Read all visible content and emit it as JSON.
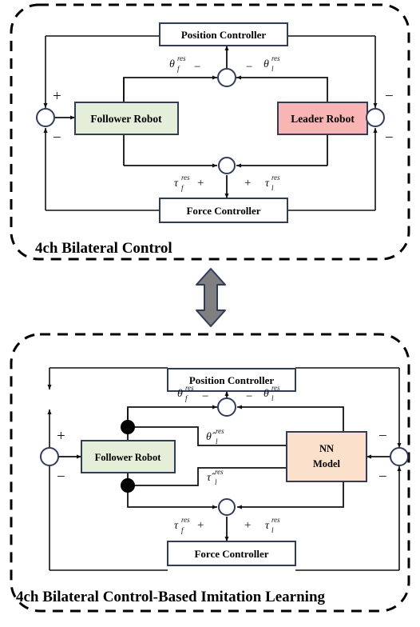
{
  "figure": {
    "type": "block-diagram",
    "description": "Two stacked dashed rounded panels showing 4ch bilateral control and its imitation-learning variant, linked by a vertical double-headed arrow."
  },
  "colors": {
    "box_border": "#2f3c5c",
    "follower_fill": "#e4eed8",
    "leader_fill": "#f9b4b4",
    "nn_fill": "#fbe0cc",
    "controller_fill": "#ffffff",
    "wire": "#111111",
    "dashed_border": "#000000",
    "swap_arrow_fill": "#808080",
    "swap_arrow_stroke": "#2f3c5c"
  },
  "top_panel": {
    "caption": "4ch Bilateral Control",
    "blocks": {
      "position_controller": "Position Controller",
      "force_controller": "Force Controller",
      "follower_robot": "Follower Robot",
      "leader_robot": "Leader Robot"
    },
    "signals": {
      "theta_f": {
        "base": "θ",
        "sub": "f",
        "sup": "res"
      },
      "theta_l": {
        "base": "θ",
        "sub": "l",
        "sup": "res"
      },
      "tau_f": {
        "base": "τ",
        "sub": "f",
        "sup": "res"
      },
      "tau_l": {
        "base": "τ",
        "sub": "l",
        "sup": "res"
      }
    },
    "signs": {
      "pos_junction_left": "−",
      "pos_junction_right": "−",
      "force_junction_left": "+",
      "force_junction_right": "+",
      "left_sum_top": "+",
      "left_sum_bottom": "−",
      "right_sum_top": "−",
      "right_sum_bottom": "−"
    }
  },
  "bottom_panel": {
    "caption": "4ch Bilateral Control-Based Imitation Learning",
    "blocks": {
      "position_controller": "Position Controller",
      "force_controller": "Force Controller",
      "follower_robot": "Follower Robot",
      "nn_model_line1": "NN",
      "nn_model_line2": "Model"
    },
    "signals": {
      "theta_f": {
        "base": "θ",
        "sub": "f",
        "sup": "res"
      },
      "theta_l": {
        "base": "θ",
        "sub": "l",
        "sup": "res"
      },
      "tau_f": {
        "base": "τ",
        "sub": "f",
        "sup": "res"
      },
      "tau_l": {
        "base": "τ",
        "sub": "l",
        "sup": "res"
      },
      "theta_l_hat": {
        "base": "θ̂",
        "sub": "l",
        "sup": "res"
      },
      "tau_l_hat": {
        "base": "τ̂",
        "sub": "l",
        "sup": "res"
      }
    },
    "signs": {
      "pos_junction_left": "−",
      "pos_junction_right": "−",
      "force_junction_left": "+",
      "force_junction_right": "+",
      "left_sum_top": "+",
      "left_sum_bottom": "−",
      "right_sum_top": "−",
      "right_sum_bottom": "−"
    }
  },
  "connector": {
    "name": "swap-double-arrow"
  }
}
